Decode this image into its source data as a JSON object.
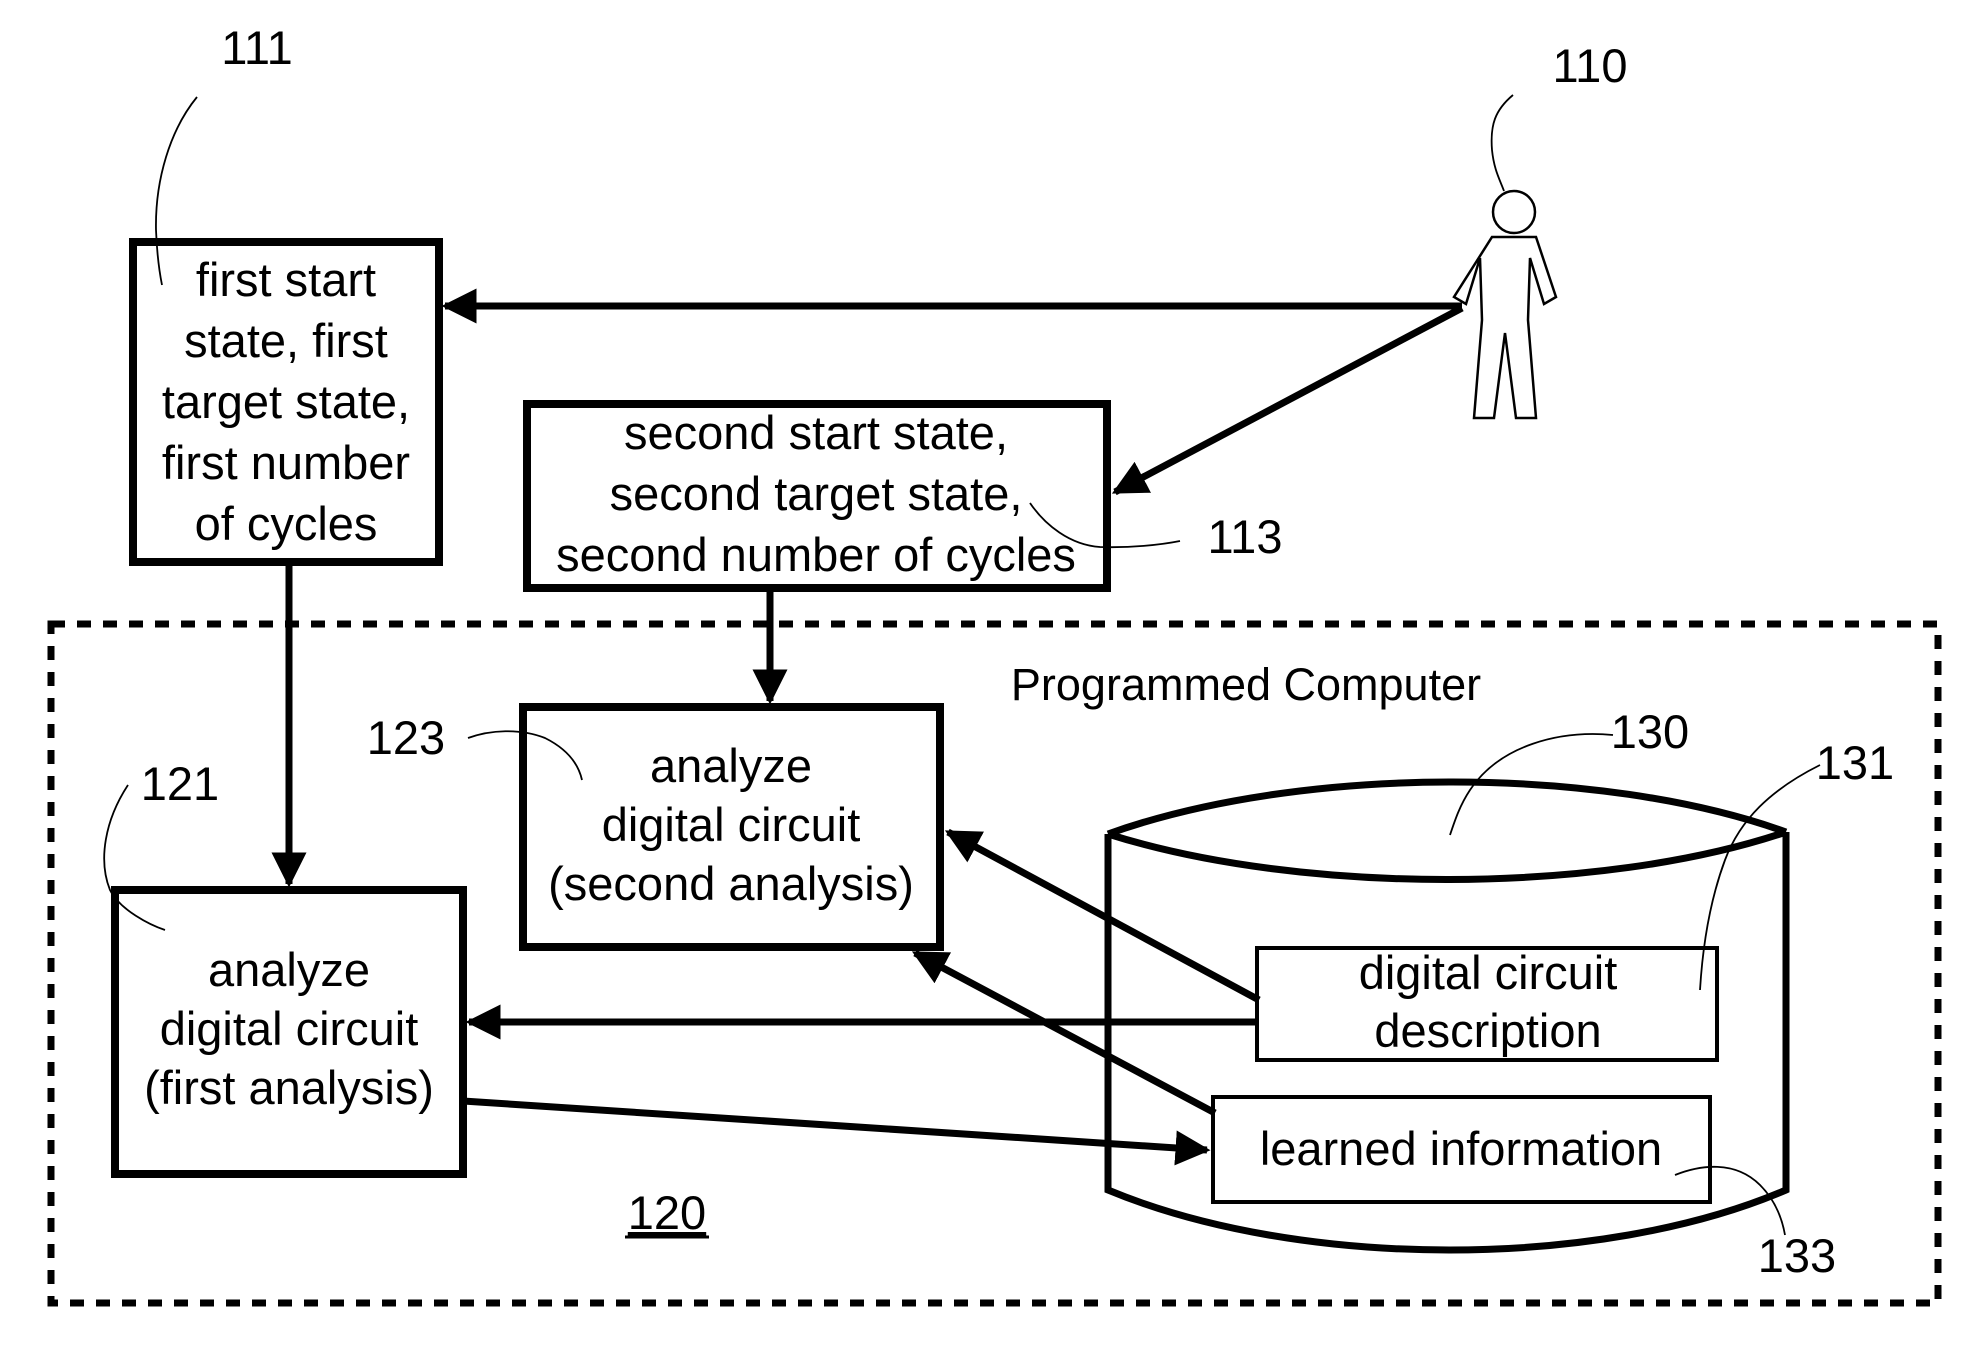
{
  "figure": {
    "system_label": "Programmed Computer",
    "system_ref": "120",
    "user_ref": "110",
    "first_inputs": {
      "ref": "111",
      "lines": [
        "first start",
        "state, first",
        "target state,",
        "first number",
        "of cycles"
      ]
    },
    "second_inputs": {
      "ref": "113",
      "lines": [
        "second start state,",
        "second target state,",
        "second number of cycles"
      ]
    },
    "first_analysis": {
      "ref": "121",
      "lines": [
        "analyze",
        "digital circuit",
        "(first analysis)"
      ]
    },
    "second_analysis": {
      "ref": "123",
      "lines": [
        "analyze",
        "digital circuit",
        "(second analysis)"
      ]
    },
    "storage": {
      "ref": "130",
      "circuit_description": {
        "ref": "131",
        "lines": [
          "digital circuit",
          "description"
        ]
      },
      "learned_information": {
        "ref": "133",
        "lines": [
          "learned information"
        ]
      }
    }
  }
}
